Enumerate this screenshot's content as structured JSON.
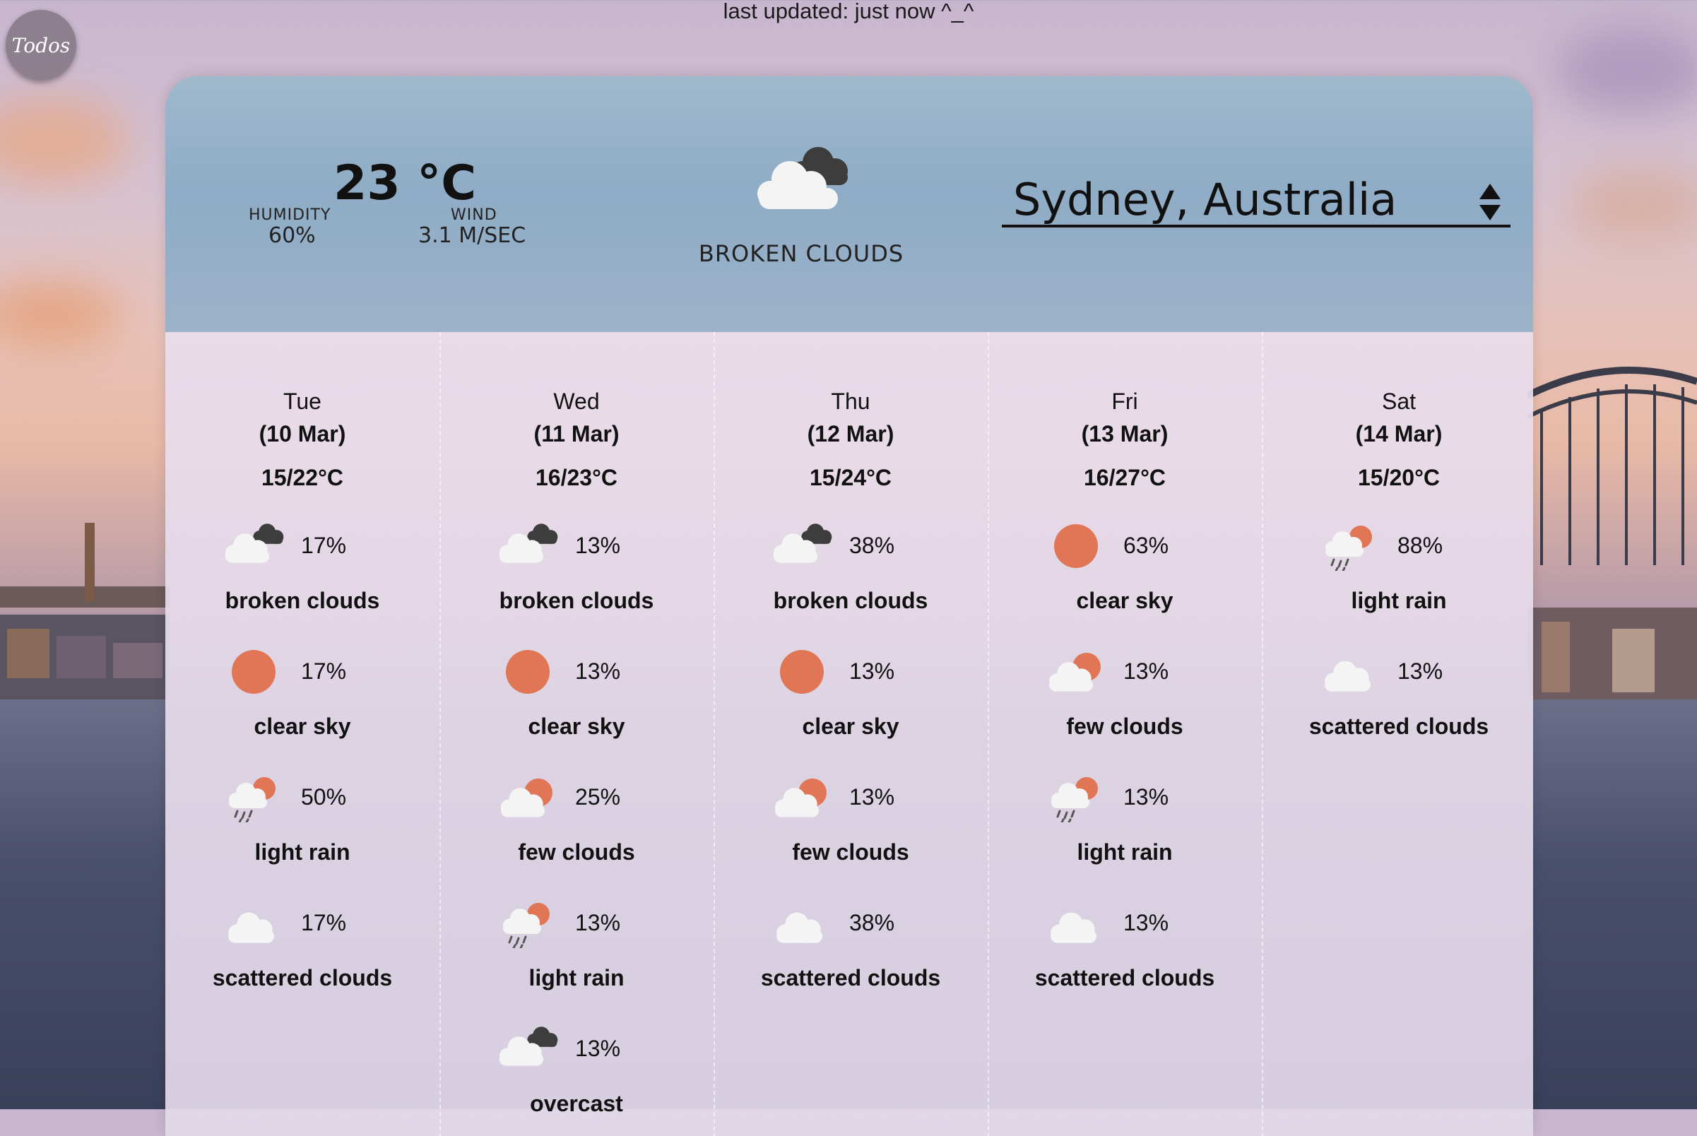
{
  "header": {
    "last_updated": "last updated: just now ^_^",
    "todos_label": "Todos"
  },
  "current": {
    "temp": "23 °C",
    "humidity_label": "HUMIDITY",
    "humidity": "60%",
    "wind_label": "WIND",
    "wind": "3.1 M/SEC",
    "icon": "broken-clouds-icon",
    "description": "BROKEN CLOUDS",
    "location": "Sydney, Australia"
  },
  "days": [
    {
      "name": "Tue",
      "date": "(10 Mar)",
      "range": "15/22°C",
      "entries": [
        {
          "icon": "broken-clouds",
          "pct": "17%",
          "desc": "broken clouds"
        },
        {
          "icon": "clear-sky",
          "pct": "17%",
          "desc": "clear sky"
        },
        {
          "icon": "light-rain",
          "pct": "50%",
          "desc": "light rain"
        },
        {
          "icon": "scattered-clouds",
          "pct": "17%",
          "desc": "scattered clouds"
        }
      ]
    },
    {
      "name": "Wed",
      "date": "(11 Mar)",
      "range": "16/23°C",
      "entries": [
        {
          "icon": "broken-clouds",
          "pct": "13%",
          "desc": "broken clouds"
        },
        {
          "icon": "clear-sky",
          "pct": "13%",
          "desc": "clear sky"
        },
        {
          "icon": "few-clouds",
          "pct": "25%",
          "desc": "few clouds"
        },
        {
          "icon": "light-rain",
          "pct": "13%",
          "desc": "light rain"
        },
        {
          "icon": "broken-clouds",
          "pct": "13%",
          "desc": "overcast"
        }
      ]
    },
    {
      "name": "Thu",
      "date": "(12 Mar)",
      "range": "15/24°C",
      "entries": [
        {
          "icon": "broken-clouds",
          "pct": "38%",
          "desc": "broken clouds"
        },
        {
          "icon": "clear-sky",
          "pct": "13%",
          "desc": "clear sky"
        },
        {
          "icon": "few-clouds",
          "pct": "13%",
          "desc": "few clouds"
        },
        {
          "icon": "scattered-clouds",
          "pct": "38%",
          "desc": "scattered clouds"
        }
      ]
    },
    {
      "name": "Fri",
      "date": "(13 Mar)",
      "range": "16/27°C",
      "entries": [
        {
          "icon": "clear-sky",
          "pct": "63%",
          "desc": "clear sky"
        },
        {
          "icon": "few-clouds",
          "pct": "13%",
          "desc": "few clouds"
        },
        {
          "icon": "light-rain",
          "pct": "13%",
          "desc": "light rain"
        },
        {
          "icon": "scattered-clouds",
          "pct": "13%",
          "desc": "scattered clouds"
        }
      ]
    },
    {
      "name": "Sat",
      "date": "(14 Mar)",
      "range": "15/20°C",
      "entries": [
        {
          "icon": "light-rain",
          "pct": "88%",
          "desc": "light rain"
        },
        {
          "icon": "scattered-clouds",
          "pct": "13%",
          "desc": "scattered clouds"
        }
      ]
    }
  ],
  "colors": {
    "sun": "#e07655",
    "cloud": "#f4f4f4",
    "dark_cloud": "#3d3d3d",
    "rain": "#555"
  }
}
